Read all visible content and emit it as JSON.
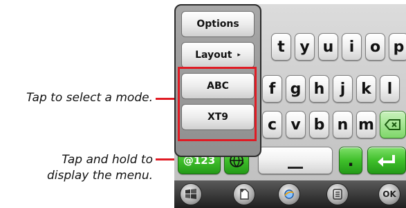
{
  "callouts": {
    "mode": "Tap to select a mode.",
    "menu_line1": "Tap and hold to",
    "menu_line2": "display the menu."
  },
  "menu": {
    "items": [
      {
        "label": "Options"
      },
      {
        "label": "Layout"
      },
      {
        "label": "ABC"
      },
      {
        "label": "XT9"
      }
    ],
    "layout_arrow": "▸"
  },
  "keyboard": {
    "row1": [
      "t",
      "y",
      "u",
      "i",
      "o",
      "p"
    ],
    "row2": [
      "f",
      "g",
      "h",
      "j",
      "k",
      "l"
    ],
    "row3": [
      "c",
      "v",
      "b",
      "n",
      "m"
    ],
    "sym_key": "@123",
    "period_key": ".",
    "enter_icon": "enter-icon",
    "backspace_icon": "backspace-icon",
    "globe_icon": "globe-icon"
  },
  "taskbar": {
    "ok_label": "OK"
  },
  "colors": {
    "highlight": "#e01b24",
    "key_green": "#3fbf2a"
  }
}
